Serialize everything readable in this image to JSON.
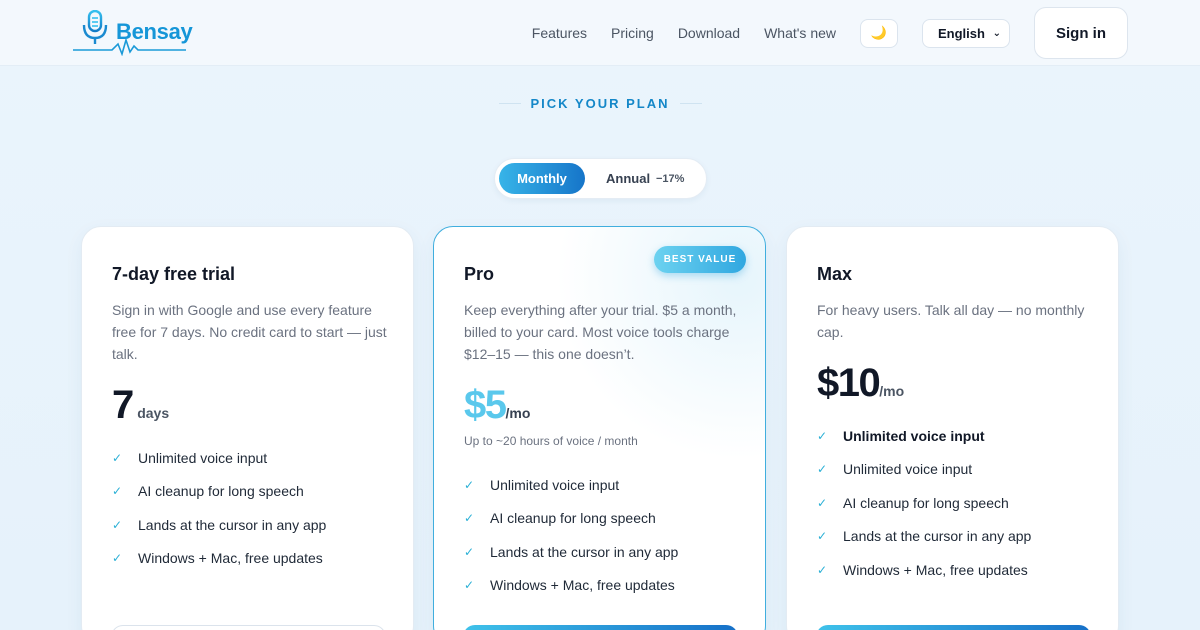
{
  "brand": {
    "name": "Bensay"
  },
  "nav": {
    "links": [
      "Features",
      "Pricing",
      "Download",
      "What's new"
    ],
    "theme_icon": "moon-icon",
    "language": "English",
    "signin_label": "Sign in"
  },
  "section": {
    "eyebrow": "PICK YOUR PLAN"
  },
  "billing": {
    "monthly_label": "Monthly",
    "annual_label": "Annual",
    "annual_discount": "−17%",
    "selected": "monthly"
  },
  "plans": [
    {
      "title": "7-day free trial",
      "description": "Sign in with Google and use every feature free for 7 days. No credit card to start — just talk.",
      "price": "7",
      "unit": "days",
      "note": "",
      "features": [
        "Unlimited voice input",
        "AI cleanup for long speech",
        "Lands at the cursor in any app",
        "Windows + Mac, free updates"
      ]
    },
    {
      "title": "Pro",
      "badge": "BEST VALUE",
      "description": "Keep everything after your trial. $5 a month, billed to your card. Most voice tools charge $12–15 — this one doesn’t.",
      "price": "$5",
      "unit": "/mo",
      "note": "Up to ~20 hours of voice / month",
      "features": [
        "Unlimited voice input",
        "AI cleanup for long speech",
        "Lands at the cursor in any app",
        "Windows + Mac, free updates"
      ]
    },
    {
      "title": "Max",
      "description": "For heavy users. Talk all day — no monthly cap.",
      "price": "$10",
      "unit": "/mo",
      "note": "",
      "features": [
        "Unlimited voice input",
        "Unlimited voice input",
        "AI cleanup for long speech",
        "Lands at the cursor in any app",
        "Windows + Mac, free updates"
      ]
    }
  ],
  "colors": {
    "accent": "#1487c8",
    "accent_light": "#5ac8ec",
    "check": "#2bb0d6"
  }
}
